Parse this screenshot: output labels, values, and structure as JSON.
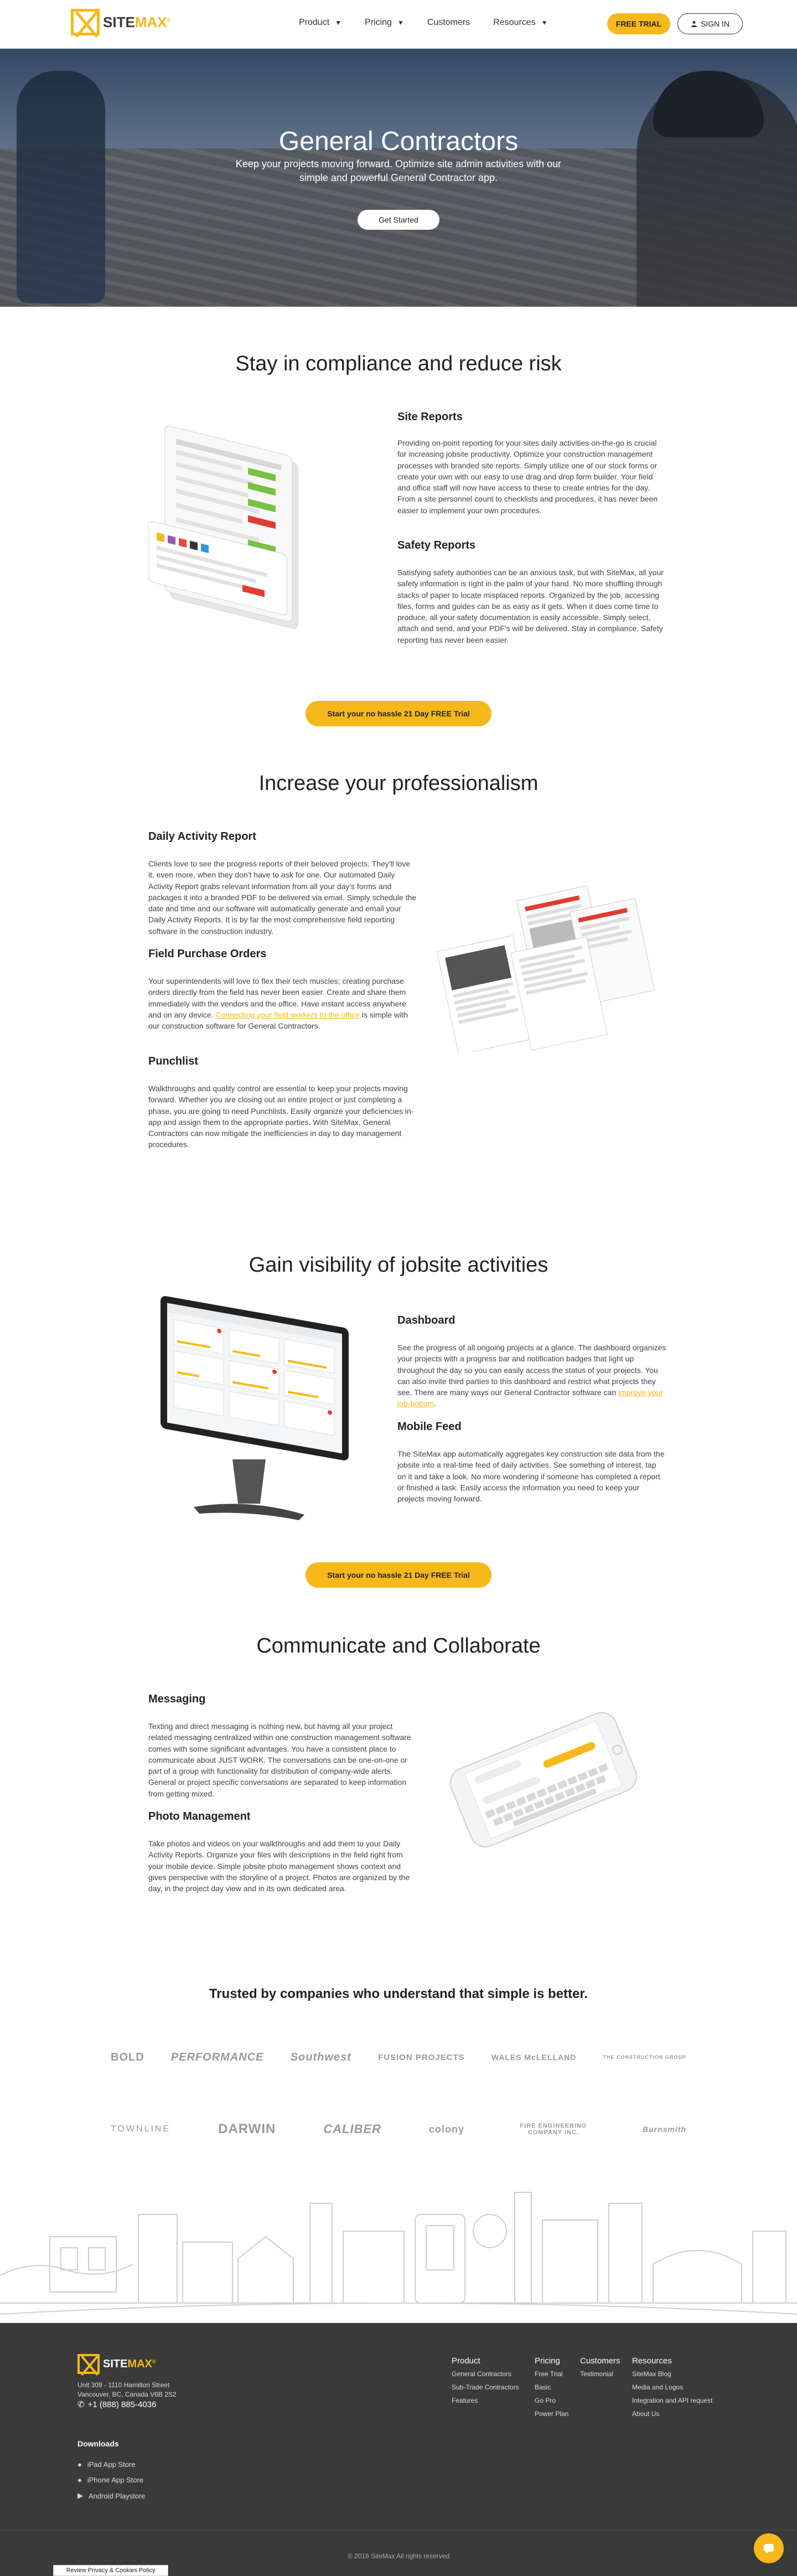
{
  "header": {
    "logo_site": "SITE",
    "logo_max": "MAX",
    "logo_reg": "®",
    "nav": [
      {
        "label": "Product",
        "has_dropdown": true
      },
      {
        "label": "Pricing",
        "has_dropdown": true
      },
      {
        "label": "Customers",
        "has_dropdown": false
      },
      {
        "label": "Resources",
        "has_dropdown": true
      }
    ],
    "free_trial": "FREE TRIAL",
    "sign_in": "SIGN IN"
  },
  "hero": {
    "title": "General Contractors",
    "subtitle": "Keep your projects moving forward. Optimize site admin activities with our simple and powerful General Contractor app.",
    "button": "Get Started"
  },
  "compliance": {
    "title": "Stay in compliance and reduce risk",
    "site_reports_title": "Site Reports",
    "site_reports_body": "Providing on-point reporting for your sites daily activities on-the-go is crucial for increasing jobsite productivity. Optimize your construction management processes with branded site reports. Simply utilize one of our stock forms or create your own with our easy to use drag and drop form builder. Your field and office staff will now have access to these to create entries for the day. From a site personnel count to checklists and procedures, it has never been easier to implement your own procedures.",
    "safety_title": "Safety Reports",
    "safety_body": "Satisfying safety authorities can be an anxious task, but with SiteMax, all your safety information is right in the palm of your hand. No more shuffling through stacks of paper to locate misplaced reports. Organized by the job, accessing files, forms and guides can be as easy as it gets. When it does come time to produce, all your safety documentation is easily accessible. Simply select, attach and send, and your PDF's will be delivered. Stay in compliance. Safety reporting has never been easier."
  },
  "cta_1": "Start your no hassle 21 Day FREE Trial",
  "professionalism": {
    "title": "Increase your professionalism",
    "dar_title": "Daily Activity Report",
    "dar_body": "Clients love to see the progress reports of their beloved projects. They'll love it, even more, when they don't have to ask for one. Our automated Daily Activity Report grabs relevant information from all your day's forms and packages it into a branded PDF to be delivered via email. Simply schedule the date and time and our software will automatically generate and email your Daily Activity Reports. It is by far the most comprehensive field reporting software in the construction industry.",
    "fpo_title": "Field Purchase Orders",
    "fpo_body_1": "Your superintendents will love to flex their tech muscles; creating purchase orders directly from the field has never been easier.  Create and share them immediately with the vendors and the office. Have instant access anywhere and on any device.",
    "fpo_link": "Connecting your field workers to the office",
    "fpo_body_2": " is simple with our construction software for General Contractors.",
    "punch_title": "Punchlist",
    "punch_body": "Walkthroughs and quality control are essential to keep your projects moving forward. Whether you are closing out an entire project or just completing a phase, you are going to need Punchlists. Easily organize your deficiencies in-app and assign them to the appropriate parties. With SiteMax, General Contractors can now mitigate the inefficiencies in day to day management procedures."
  },
  "visibility": {
    "title": "Gain visibility of jobsite activities",
    "dash_title": "Dashboard",
    "dash_body_1": "See the progress of all ongoing projects at a glance. The dashboard organizes your projects with a progress bar and notification badges that light up throughout the day so you can easily access the status of your projects. You can also invite third parties to this dashboard and restrict what projects they see. There are many ways our General Contractor software can ",
    "dash_link": "improve your job-bottom",
    "dash_body_2": ".",
    "feed_title": "Mobile Feed",
    "feed_body": "The SiteMax app automatically aggregates key construction site data from the jobsite into a real-time feed of daily activities. See something of interest, tap on it and take a look. No more wondering if someone has completed a report or finished a task. Easily access the information you need to keep your projects moving forward."
  },
  "cta_2": "Start your no hassle 21 Day FREE Trial",
  "communicate": {
    "title": "Communicate and Collaborate",
    "msg_title": "Messaging",
    "msg_body": "Texting and direct messaging is nothing new, but having all your project related messaging centralized within one construction management software comes with some significant advantages. You have a consistent place to communicate about JUST WORK. The conversations can be one-on-one or part of a group with functionality for distribution of company-wide alerts. General or project specific conversations are separated to keep information from getting mixed.",
    "photo_title": "Photo Management",
    "photo_body": "Take photos and videos on your walkthroughs and add them to your Daily Activity Reports. Organize your files with descriptions in the field right from your mobile device. Simple jobsite photo management shows context and gives perspective with the storyline of a project.  Photos are organized by the day, in the project day view and in its own dedicated area."
  },
  "trusted": {
    "title": "Trusted by companies who understand that simple is better.",
    "row1": [
      "BOLD",
      "PERFORMANCE",
      "Southwest",
      "FUSION PROJECTS",
      "WALES McLELLAND",
      "THE CONSTRUCTION GROUP"
    ],
    "row2": [
      "TOWNLINE",
      "DARWIN",
      "CALIBER",
      "colony",
      "FIRE ENGINEERING COMPANY INC.",
      "Burnsmith"
    ]
  },
  "footer": {
    "address_1": "Unit 309 - 1110 Hamilton Street",
    "address_2": "Vancouver, BC, Canada V6B 2S2",
    "phone": "+1 (888) 885-4036",
    "downloads_title": "Downloads",
    "downloads": [
      "iPad App Store",
      "iPhone App Store",
      "Android Playstore"
    ],
    "columns": [
      {
        "title": "Product",
        "links": [
          "General Contractors",
          "Sub-Trade Contractors",
          "Features"
        ]
      },
      {
        "title": "Pricing",
        "links": [
          "Free Trial",
          "Basic",
          "Go Pro",
          "Power Plan"
        ]
      },
      {
        "title": "Customers",
        "links": [
          "Testimonial"
        ]
      },
      {
        "title": "Resources",
        "links": [
          "SiteMax Blog",
          "Media and Logos",
          "Integration and API request",
          "About Us"
        ]
      }
    ],
    "copyright": "© 2018 SiteMax All rights reserved"
  },
  "privacy": "Review Privacy & Cookies Policy",
  "colors": {
    "accent": "#f6b81a",
    "footer_bg": "#3a3a3a"
  }
}
